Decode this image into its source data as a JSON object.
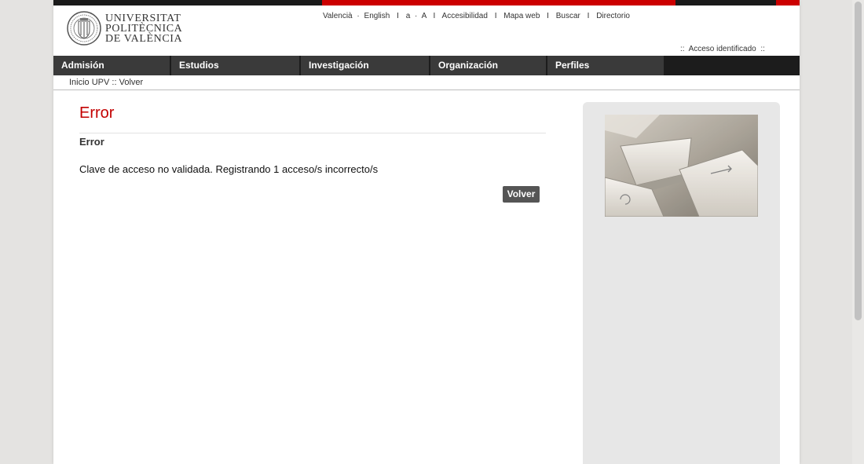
{
  "header": {
    "logo": {
      "line1": "UNIVERSITAT",
      "line2": "POLITÈCNICA",
      "line3": "DE VALÈNCIA"
    },
    "top_links": {
      "valencia": "Valencià",
      "dot1": "·",
      "english": "English",
      "sep1": "I",
      "font_small": "a",
      "dot2": "·",
      "font_large": "A",
      "sep2": "I",
      "accessibility": "Accesibilidad",
      "sep3": "I",
      "sitemap": "Mapa web",
      "sep4": "I",
      "search": "Buscar",
      "sep5": "I",
      "directory": "Directorio"
    },
    "access": {
      "prefix": "::",
      "label": "Acceso identificado",
      "suffix": "::"
    }
  },
  "nav": {
    "items": [
      {
        "label": "Admisión"
      },
      {
        "label": "Estudios"
      },
      {
        "label": "Investigación"
      },
      {
        "label": "Organización"
      },
      {
        "label": "Perfiles"
      }
    ]
  },
  "breadcrumb": {
    "home": "Inicio UPV",
    "separator": "::",
    "back": "Volver"
  },
  "main": {
    "title": "Error",
    "subtitle": "Error",
    "message": "Clave de acceso no validada. Registrando 1 acceso/s incorrecto/s",
    "back_button": "Volver"
  },
  "colors": {
    "brand_red": "#c30000",
    "nav_bg": "#1c1c1c",
    "nav_item": "#3a3a3a"
  }
}
